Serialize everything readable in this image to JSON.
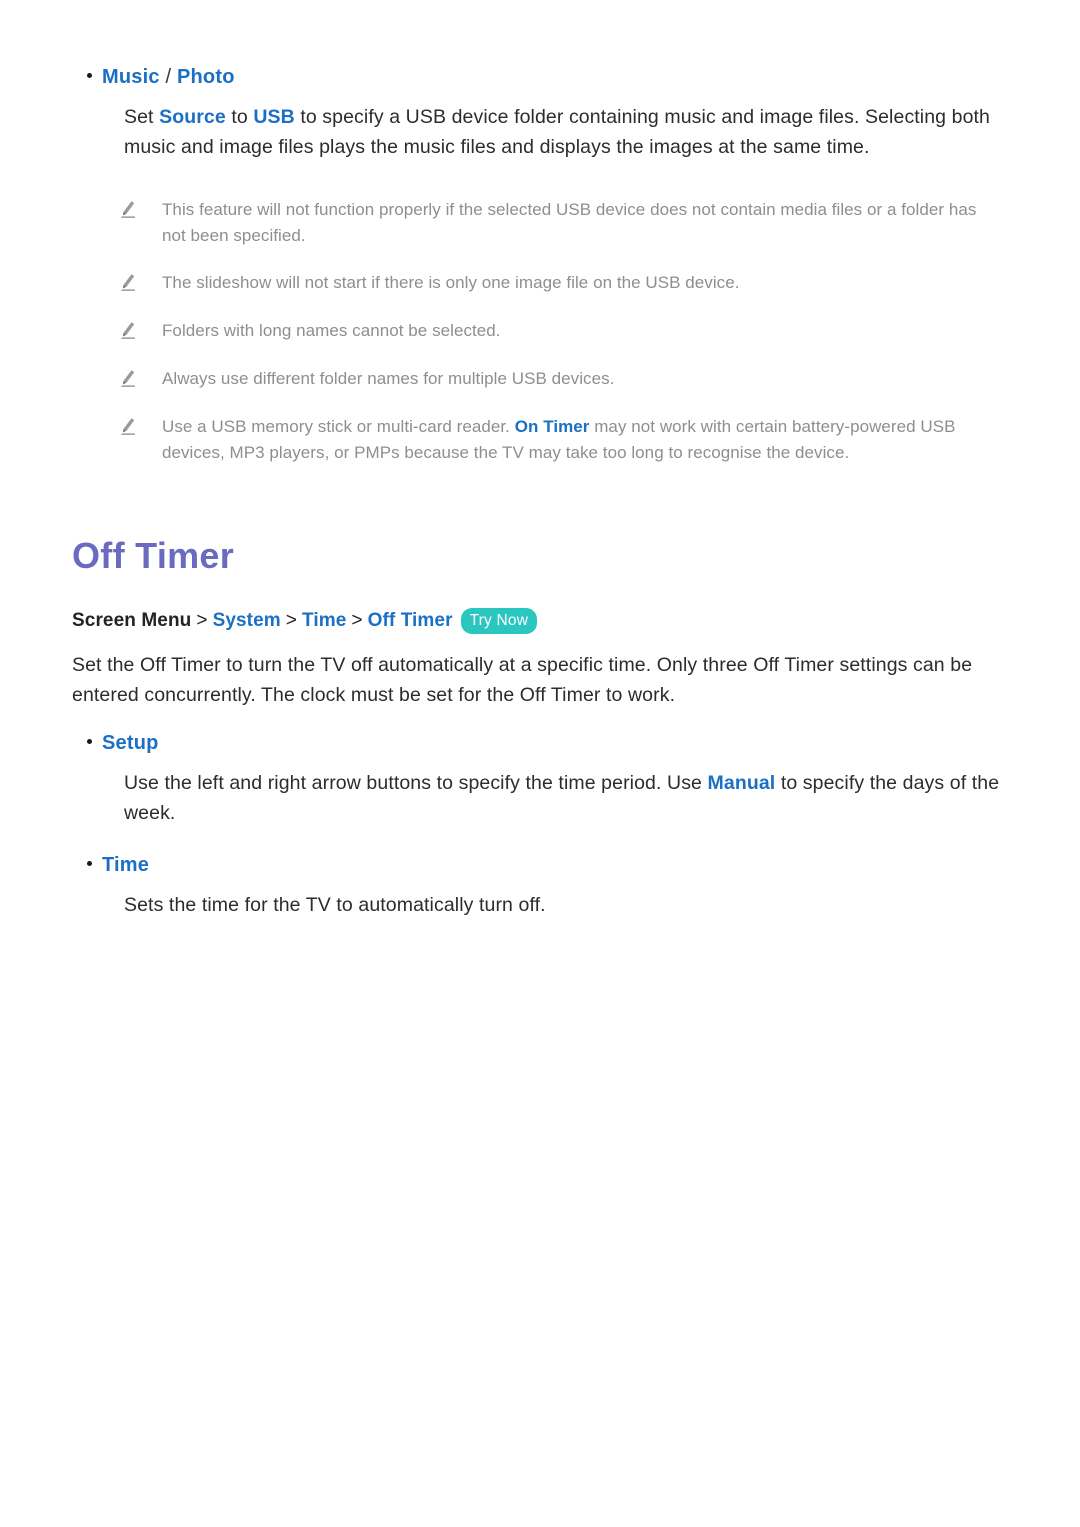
{
  "page": {
    "background": "#ffffff",
    "accent_blue": "#1b6fc4",
    "heading_purple": "#6a6ac0",
    "badge_teal": "#2cc6c0",
    "note_gray": "#8e8e8e"
  },
  "music_photo_section": {
    "bullet_term_primary": "Music",
    "bullet_term_separator": " / ",
    "bullet_term_secondary": "Photo",
    "paragraph": {
      "part1": "Set ",
      "kw1": "Source",
      "part2": " to ",
      "kw2": "USB",
      "part3": " to specify a USB device folder containing music and image files. Selecting both music and image files plays the music files and displays the images at the same time."
    },
    "notes": [
      {
        "icon": "pencil-icon",
        "text": "This feature will not function properly if the selected USB device does not contain media files or a folder has not been specified."
      },
      {
        "icon": "pencil-icon",
        "text": "The slideshow will not start if there is only one image file on the USB device."
      },
      {
        "icon": "pencil-icon",
        "text": "Folders with long names cannot be selected."
      },
      {
        "icon": "pencil-icon",
        "text": "Always use different folder names for multiple USB devices."
      }
    ],
    "note_with_link": {
      "icon": "pencil-icon",
      "part1": "Use a USB memory stick or multi-card reader. ",
      "kw": "On Timer",
      "part2": " may not work with certain battery-powered USB devices, MP3 players, or PMPs because the TV may take too long to recognise the device."
    }
  },
  "off_timer_section": {
    "heading": "Off Timer",
    "breadcrumb": {
      "root": "Screen Menu",
      "separator": ">",
      "items": [
        "System",
        "Time",
        "Off Timer"
      ],
      "badge": "Try Now"
    },
    "intro_paragraph": "Set the Off Timer to turn the TV off automatically at a specific time. Only three Off Timer settings can be entered concurrently. The clock must be set for the Off Timer to work.",
    "setup": {
      "term": "Setup",
      "description": {
        "part1": "Use the left and right arrow buttons to specify the time period. Use ",
        "kw": "Manual",
        "part2": " to specify the days of the week."
      }
    },
    "time": {
      "term": "Time",
      "description": "Sets the time for the TV to automatically turn off."
    }
  }
}
